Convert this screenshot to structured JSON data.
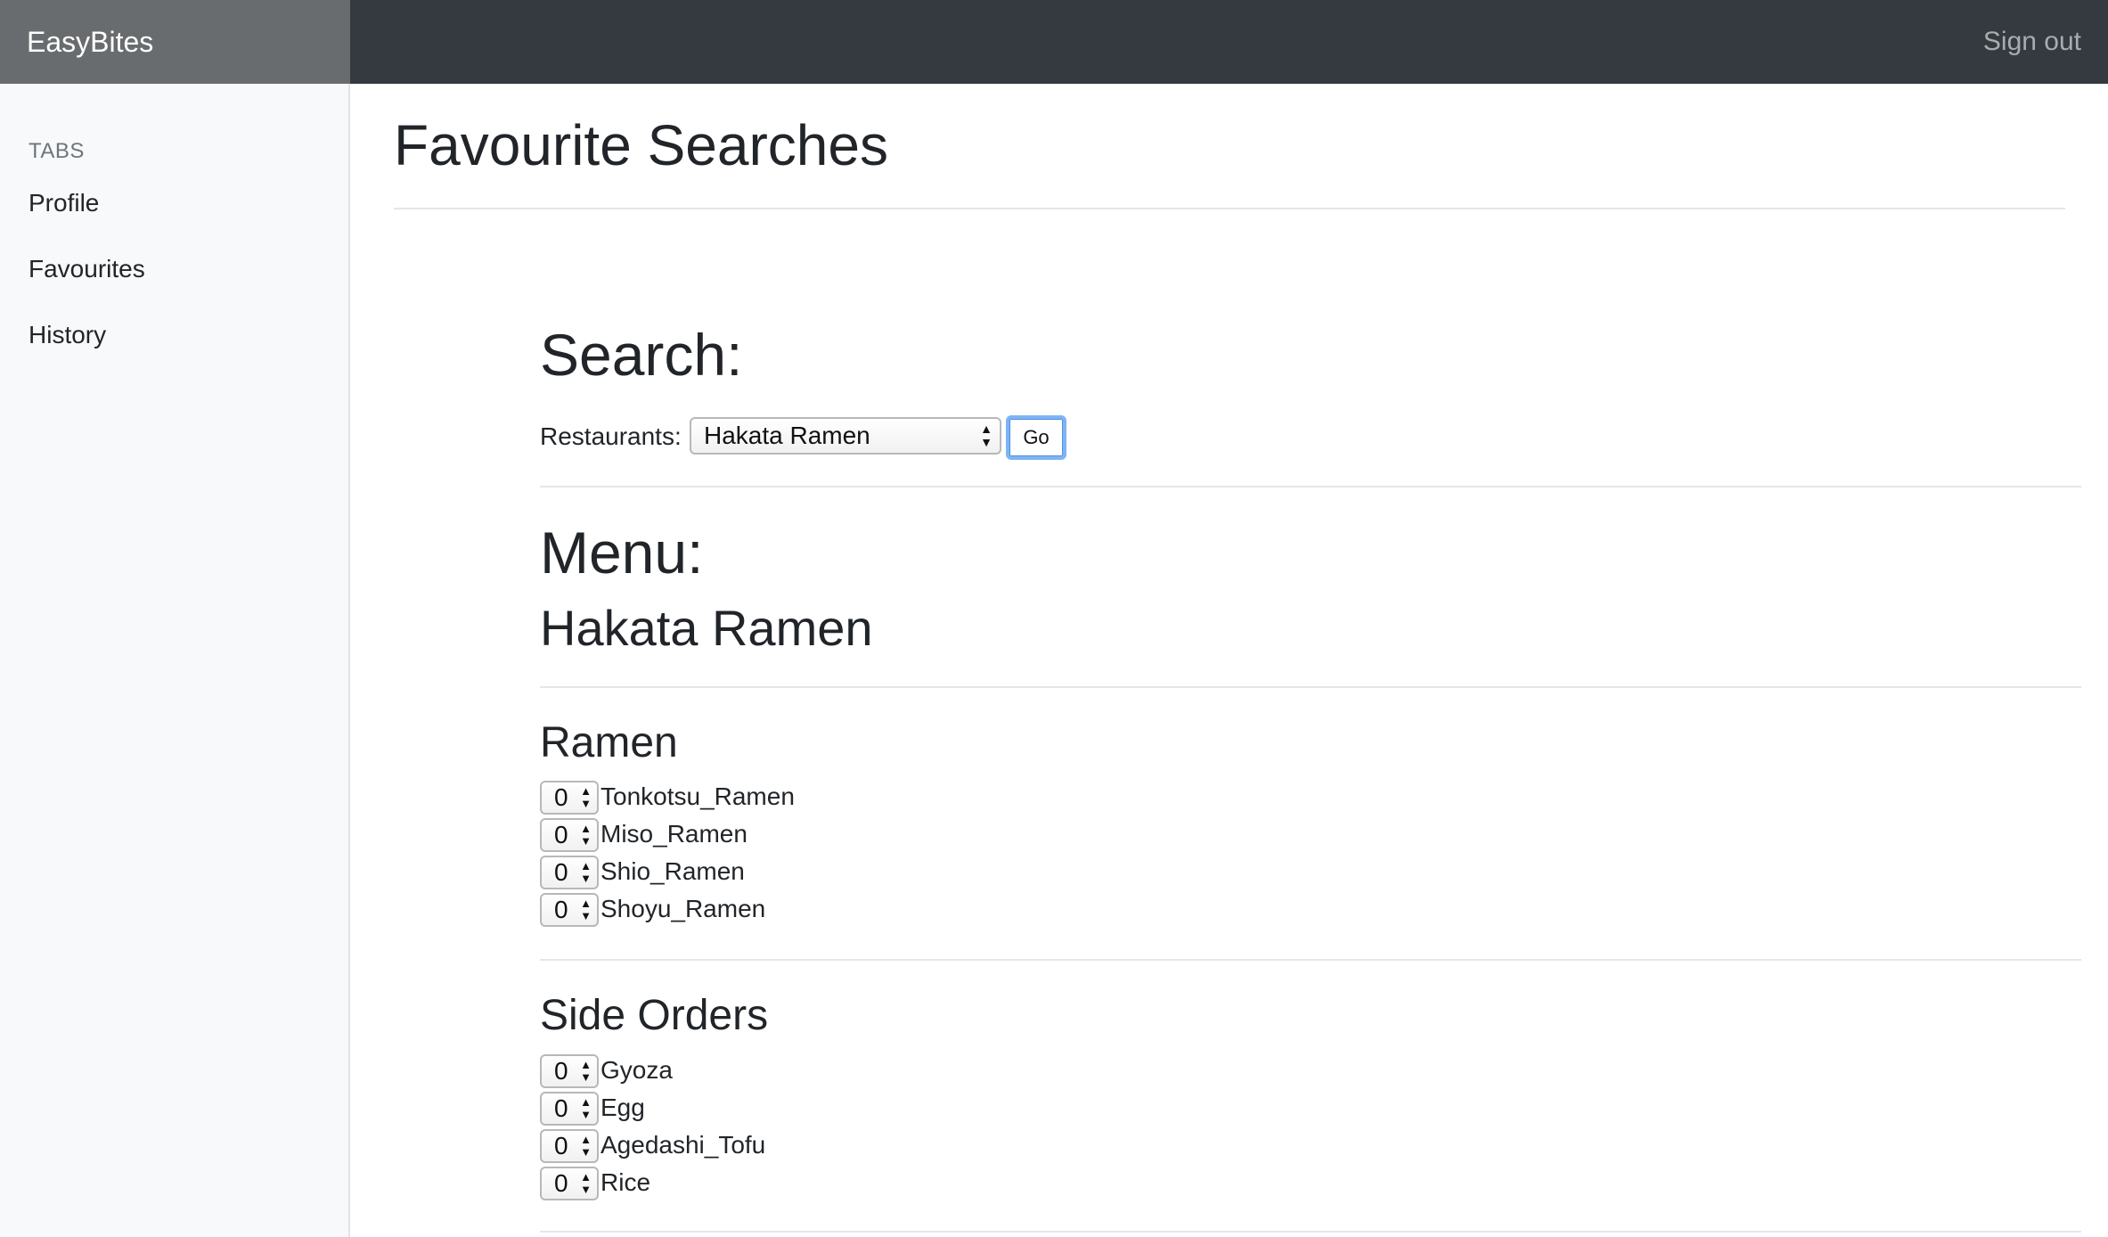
{
  "navbar": {
    "brand": "EasyBites",
    "sign_out": "Sign out"
  },
  "sidebar": {
    "heading": "TABS",
    "items": [
      {
        "label": "Profile"
      },
      {
        "label": "Favourites"
      },
      {
        "label": "History"
      }
    ]
  },
  "main": {
    "page_title": "Favourite Searches",
    "search": {
      "heading": "Search:",
      "restaurants_label": "Restaurants:",
      "selected_restaurant": "Hakata Ramen",
      "go_label": "Go"
    },
    "menu": {
      "heading": "Menu:",
      "restaurant_name": "Hakata Ramen",
      "categories": [
        {
          "name": "Ramen",
          "items": [
            {
              "name": "Tonkotsu_Ramen",
              "qty": "0"
            },
            {
              "name": "Miso_Ramen",
              "qty": "0"
            },
            {
              "name": "Shio_Ramen",
              "qty": "0"
            },
            {
              "name": "Shoyu_Ramen",
              "qty": "0"
            }
          ]
        },
        {
          "name": "Side Orders",
          "items": [
            {
              "name": "Gyoza",
              "qty": "0"
            },
            {
              "name": "Egg",
              "qty": "0"
            },
            {
              "name": "Agedashi_Tofu",
              "qty": "0"
            },
            {
              "name": "Rice",
              "qty": "0"
            }
          ]
        }
      ]
    }
  }
}
